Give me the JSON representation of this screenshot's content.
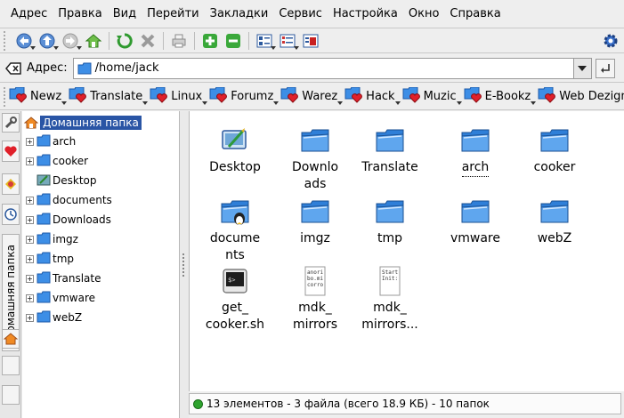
{
  "menu": [
    "Адрес",
    "Правка",
    "Вид",
    "Перейти",
    "Закладки",
    "Сервис",
    "Настройка",
    "Окно",
    "Справка"
  ],
  "location": {
    "label": "Адрес:",
    "value": "/home/jack"
  },
  "bookmarks": [
    "Newz",
    "Translate",
    "Linux",
    "Forumz",
    "Warez",
    "Hack",
    "Muzic",
    "E-Bookz",
    "Web Dezign"
  ],
  "bookmarks_more": "»",
  "sidebar": {
    "home_tab_label": "Домашняя папка"
  },
  "tree": {
    "root": "Домашняя папка",
    "items": [
      "arch",
      "cooker",
      "Desktop",
      "documents",
      "Downloads",
      "imgz",
      "tmp",
      "Translate",
      "vmware",
      "webZ"
    ]
  },
  "files": [
    {
      "line1": "Desktop",
      "line2": "",
      "type": "desktop"
    },
    {
      "line1": "Downlo",
      "line2": "ads",
      "type": "folder"
    },
    {
      "line1": "Translate",
      "line2": "",
      "type": "folder"
    },
    {
      "line1": "arch",
      "line2": "",
      "type": "folder"
    },
    {
      "line1": "cooker",
      "line2": "",
      "type": "folder"
    },
    {
      "line1": "docume",
      "line2": "nts",
      "type": "folder-tux"
    },
    {
      "line1": "imgz",
      "line2": "",
      "type": "folder"
    },
    {
      "line1": "tmp",
      "line2": "",
      "type": "folder"
    },
    {
      "line1": "vmware",
      "line2": "",
      "type": "folder"
    },
    {
      "line1": "webZ",
      "line2": "",
      "type": "folder"
    },
    {
      "line1": "get_",
      "line2": "cooker.sh",
      "type": "script"
    },
    {
      "line1": "mdk_",
      "line2": "mirrors",
      "type": "text",
      "preview": "anori\nbo.mi\ncorro"
    },
    {
      "line1": "mdk_",
      "line2": "mirrors...",
      "type": "text",
      "preview": "Start\nInit:"
    }
  ],
  "status": "13 элементов - 3 файла (всего 18.9 КБ) - 10 папок",
  "colors": {
    "selection": "#2a55a5",
    "folder": "#3d8ee6",
    "status_ok": "#2ea32e"
  }
}
